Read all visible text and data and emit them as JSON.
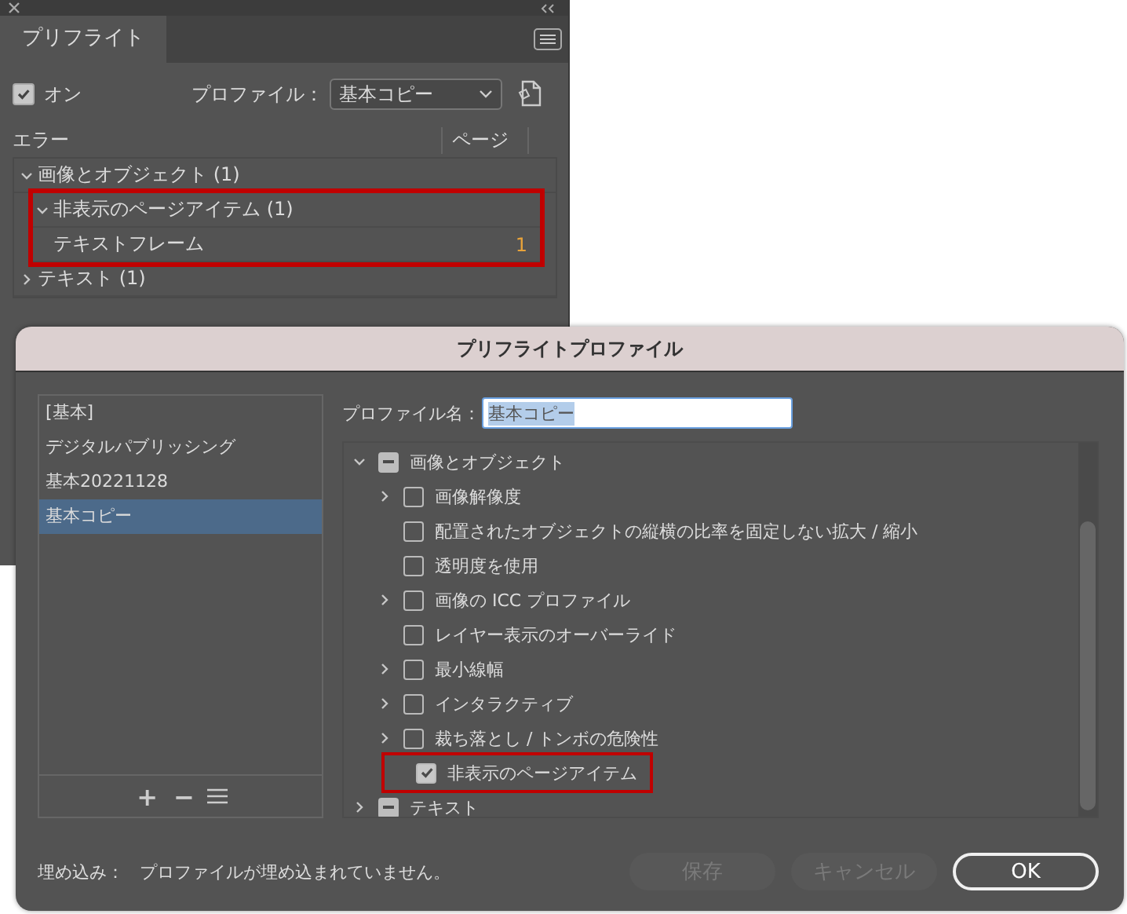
{
  "panel": {
    "tab": "プリフライト",
    "on": {
      "label": "オン",
      "checked": true
    },
    "profile_label": "プロファイル：",
    "profile_value": "基本コピー",
    "columns": [
      "エラー",
      "ページ"
    ],
    "errors": [
      {
        "label": "画像とオブジェクト (1)",
        "expanded": true,
        "highlighted": false,
        "children": [
          {
            "label": "非表示のページアイテム (1)",
            "expanded": true,
            "highlighted": true,
            "children": [
              {
                "label": "テキストフレーム",
                "page": "1",
                "highlighted": false
              }
            ]
          }
        ]
      },
      {
        "label": "テキスト (1)",
        "expanded": false,
        "highlighted": false
      }
    ]
  },
  "dialog": {
    "title": "プリフライトプロファイル",
    "profiles": [
      {
        "label": "[基本]",
        "selected": false
      },
      {
        "label": "デジタルパブリッシング",
        "selected": false
      },
      {
        "label": "基本20221128",
        "selected": false
      },
      {
        "label": "基本コピー",
        "selected": true
      }
    ],
    "list_buttons": [
      "+",
      "−"
    ],
    "name_label": "プロファイル名：",
    "name_value": "基本コピー",
    "rules": [
      {
        "kind": "group",
        "label": "画像とオブジェクト",
        "partial": true,
        "expanded": true,
        "highlighted": false,
        "children": [
          {
            "kind": "check",
            "label": "画像解像度",
            "expanded": false,
            "checked": false,
            "highlighted": false
          },
          {
            "kind": "check",
            "label": "配置されたオブジェクトの縦横の比率を固定しない拡大 / 縮小",
            "checked": false,
            "highlighted": false
          },
          {
            "kind": "check",
            "label": "透明度を使用",
            "checked": false,
            "highlighted": false
          },
          {
            "kind": "check",
            "label": "画像の ICC プロファイル",
            "expanded": false,
            "checked": false,
            "highlighted": false
          },
          {
            "kind": "check",
            "label": "レイヤー表示のオーバーライド",
            "checked": false,
            "highlighted": false
          },
          {
            "kind": "check",
            "label": "最小線幅",
            "expanded": false,
            "checked": false,
            "highlighted": false
          },
          {
            "kind": "check",
            "label": "インタラクティブ",
            "expanded": false,
            "checked": false,
            "highlighted": false
          },
          {
            "kind": "check",
            "label": "裁ち落とし / トンボの危険性",
            "expanded": false,
            "checked": false,
            "highlighted": false
          },
          {
            "kind": "check",
            "label": "非表示のページアイテム",
            "checked": true,
            "highlighted": true
          }
        ]
      },
      {
        "kind": "group",
        "label": "テキスト",
        "partial": true,
        "expanded": false,
        "highlighted": false
      }
    ],
    "embed_label": "埋め込み：",
    "embed_text": "プロファイルが埋め込まれていません。",
    "buttons": [
      {
        "label": "保存",
        "disabled": true
      },
      {
        "label": "キャンセル",
        "disabled": true
      },
      {
        "label": "OK",
        "disabled": false
      }
    ]
  }
}
